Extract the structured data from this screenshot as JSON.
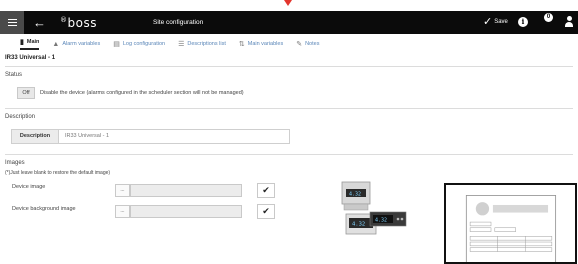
{
  "topbar": {
    "logo": "boss",
    "logo_mark": "®",
    "title": "Site configuration",
    "save_label": "Save",
    "notification_count": "0"
  },
  "tabs": [
    {
      "label": "Main",
      "icon": "device-icon"
    },
    {
      "label": "Alarm variables",
      "icon": "alarm-icon"
    },
    {
      "label": "Log configuration",
      "icon": "log-icon"
    },
    {
      "label": "Descriptions list",
      "icon": "list-icon"
    },
    {
      "label": "Main variables",
      "icon": "variables-icon"
    },
    {
      "label": "Notes",
      "icon": "notes-icon"
    }
  ],
  "device": {
    "name": "IR33 Universal - 1"
  },
  "status": {
    "heading": "Status",
    "toggle_label": "Off",
    "toggle_text": "Disable the device (alarms configured in the scheduler section will not be managed)"
  },
  "description": {
    "heading": "Description",
    "field_label": "Description",
    "field_value": "IR33 Universal - 1"
  },
  "images": {
    "heading": "Images",
    "note": "(*)Just leave blank to restore the default image)",
    "device_image_label": "Device image",
    "device_bg_label": "Device background image",
    "browse_label": "..."
  },
  "colors": {
    "topbar": "#0b0b0b",
    "tab_link": "#5a86b8",
    "marker": "#e3352d"
  }
}
